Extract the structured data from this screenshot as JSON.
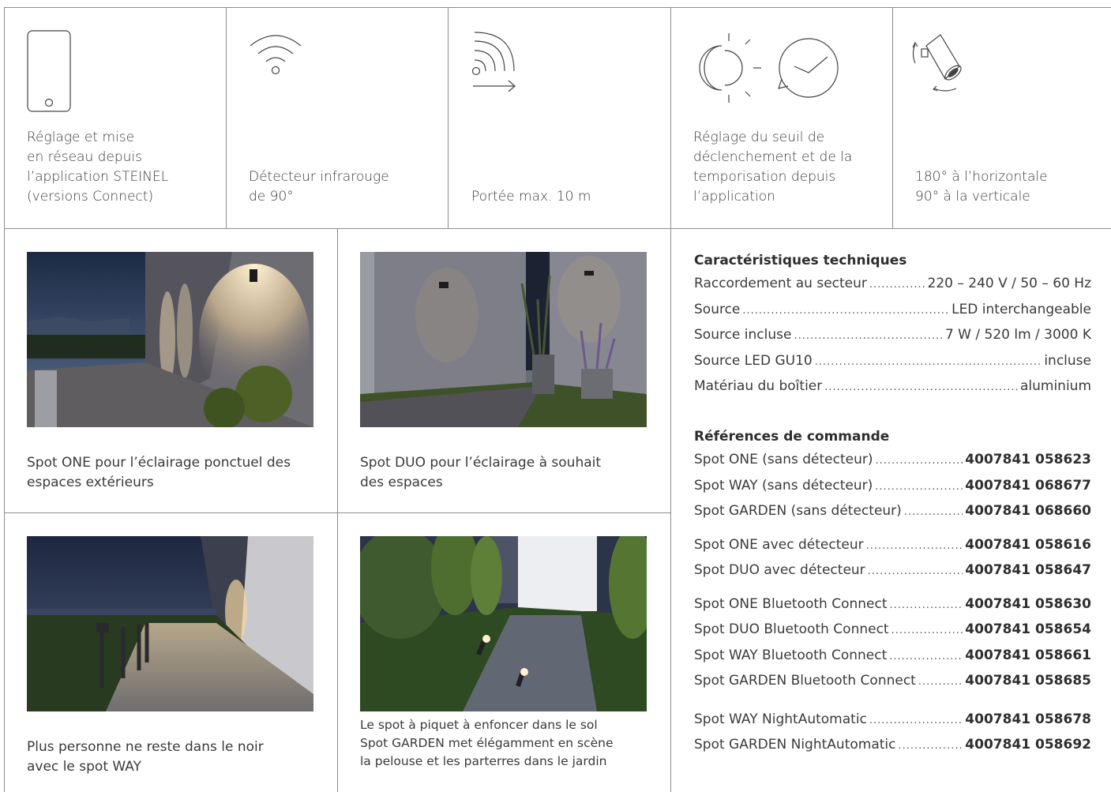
{
  "features": [
    {
      "icon": "smartphone-icon",
      "text": "Réglage et mise\nen réseau depuis\nl’application STEINEL\n(versions Connect)"
    },
    {
      "icon": "wifi-icon",
      "text": "Détecteur infrarouge\nde 90°"
    },
    {
      "icon": "detection-range-icon",
      "text": "Portée max. 10 m"
    },
    {
      "icon": "light-threshold-timer-icon",
      "text": "Réglage du seuil de\ndéclenchement et de la\ntemporisation depuis\nl’application"
    },
    {
      "icon": "rotating-spot-icon",
      "text": "180° à l’horizontale\n90° à la verticale"
    }
  ],
  "products": [
    {
      "image": "spot-one-photo",
      "caption": "Spot ONE pour l’éclairage ponctuel des\nespaces extérieurs"
    },
    {
      "image": "spot-duo-photo",
      "caption": "Spot DUO pour l’éclairage à souhait\ndes espaces"
    },
    {
      "image": "spot-way-photo",
      "caption": "Plus personne ne reste dans le noir\navec le spot WAY"
    },
    {
      "image": "spot-garden-photo",
      "caption": "Le spot à piquet à enfoncer dans le sol\nSpot GARDEN met élégamment en scène\nla pelouse et les parterres dans le jardin"
    }
  ],
  "specs": {
    "title": "Caractéristiques techniques",
    "rows": [
      {
        "label": "Raccordement au secteur",
        "value": "220 – 240 V / 50 – 60 Hz"
      },
      {
        "label": "Source",
        "value": "LED interchangeable"
      },
      {
        "label": "Source incluse",
        "value": "7 W / 520 lm / 3000 K"
      },
      {
        "label": "Source LED GU10",
        "value": "incluse"
      },
      {
        "label": "Matériau du boîtier",
        "value": "aluminium"
      }
    ]
  },
  "orders": {
    "title": "Références de commande",
    "groups": [
      [
        {
          "label": "Spot ONE (sans détecteur)",
          "code": "4007841 058623"
        },
        {
          "label": "Spot WAY (sans détecteur)",
          "code": "4007841 068677"
        },
        {
          "label": "Spot GARDEN (sans détecteur)",
          "code": "4007841 068660"
        }
      ],
      [
        {
          "label": "Spot ONE avec détecteur",
          "code": "4007841 058616"
        },
        {
          "label": "Spot DUO avec détecteur",
          "code": "4007841 058647"
        }
      ],
      [
        {
          "label": "Spot ONE Bluetooth Connect",
          "code": "4007841 058630"
        },
        {
          "label": "Spot DUO Bluetooth Connect",
          "code": "4007841 058654"
        },
        {
          "label": "Spot WAY Bluetooth Connect",
          "code": "4007841 058661"
        },
        {
          "label": "Spot GARDEN Bluetooth Connect",
          "code": "4007841 058685"
        }
      ],
      [
        {
          "label": "Spot WAY NightAutomatic",
          "code": "4007841 058678"
        },
        {
          "label": "Spot GARDEN NightAutomatic",
          "code": "4007841 058692"
        }
      ]
    ]
  }
}
